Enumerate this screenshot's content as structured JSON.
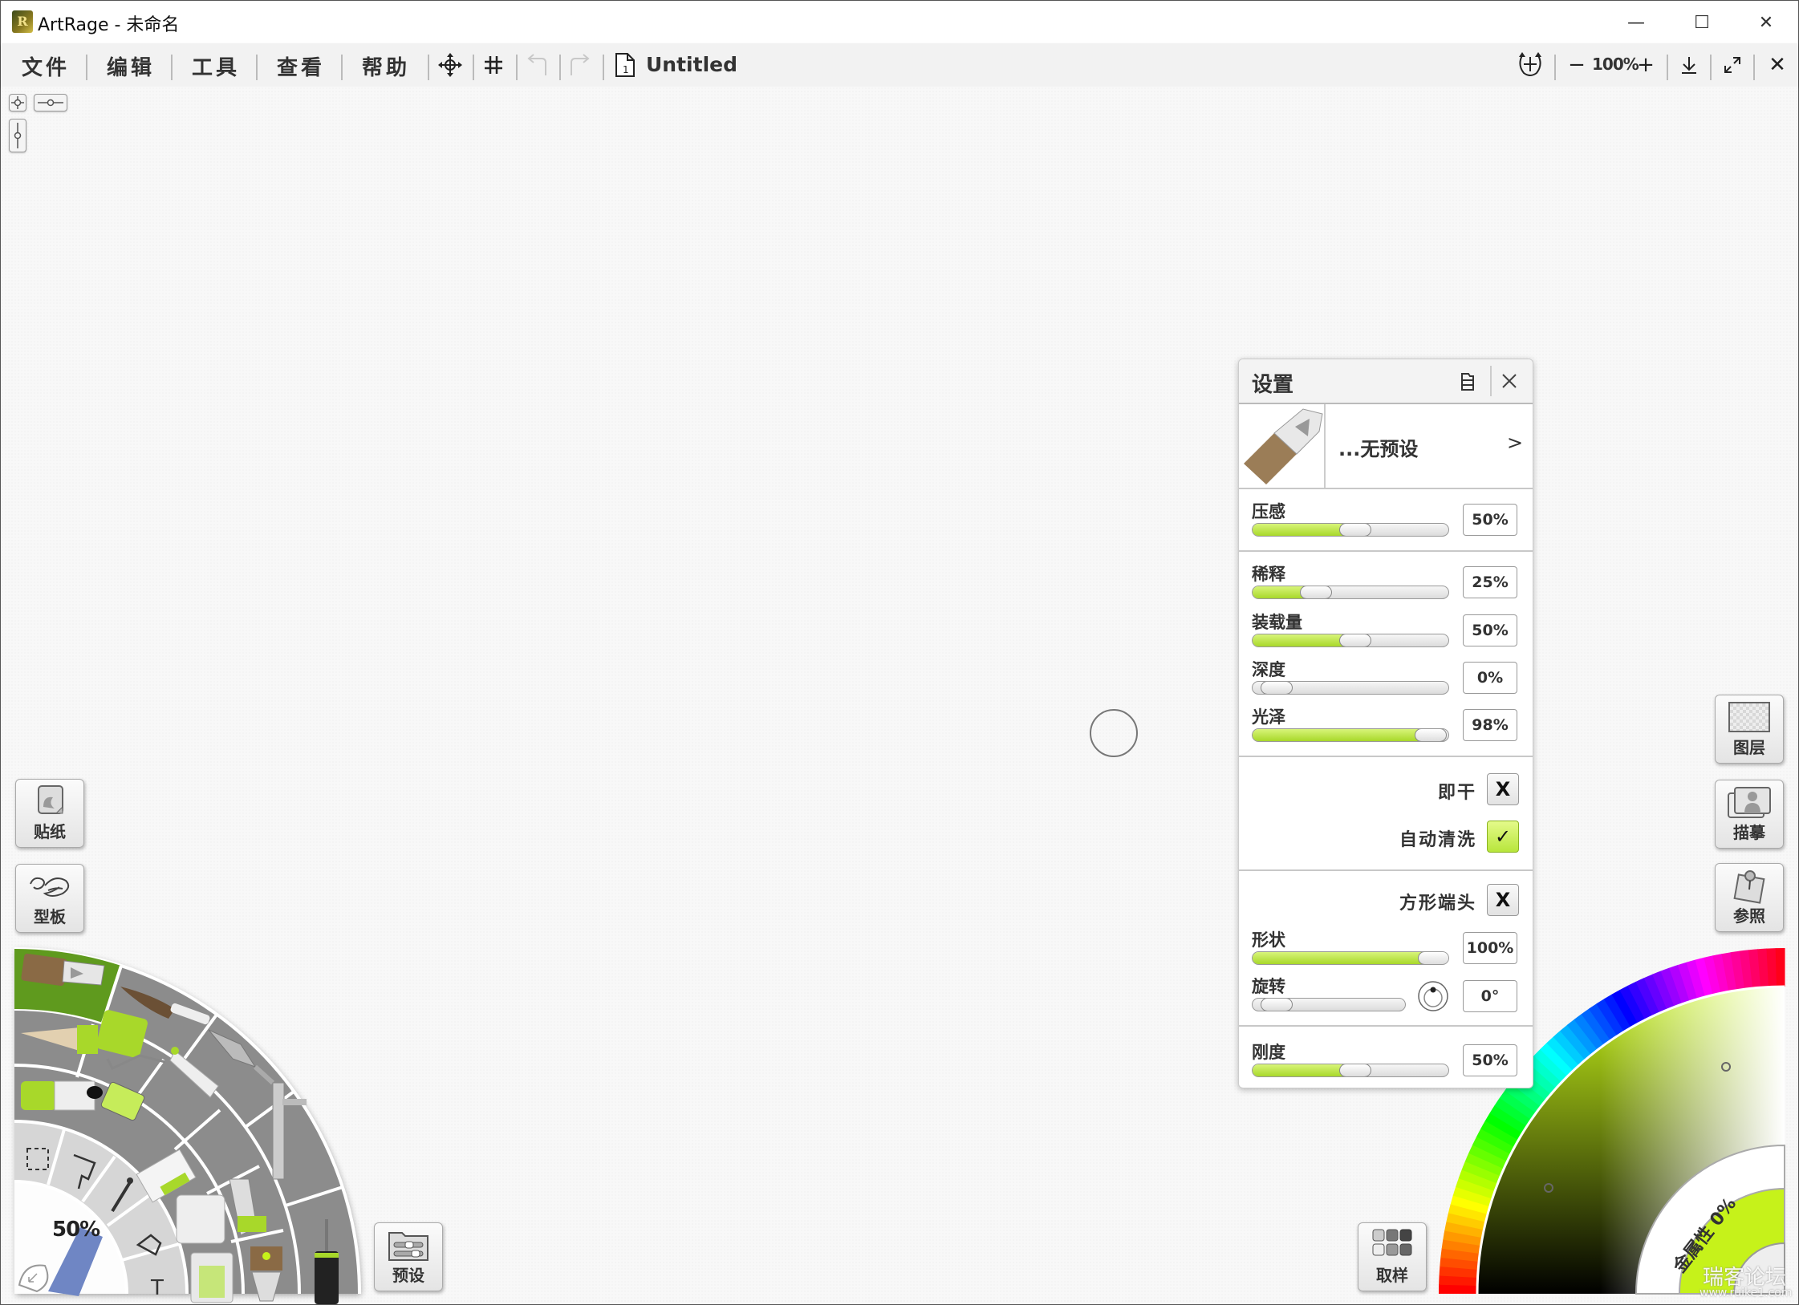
{
  "window": {
    "title": "ArtRage - 未命名",
    "app_icon_glyph": "R",
    "controls": {
      "minimize": "—",
      "maximize": "☐",
      "close": "✕"
    }
  },
  "toolbar": {
    "menus": [
      "文件",
      "编辑",
      "工具",
      "查看",
      "帮助"
    ],
    "icons": [
      "move-canvas-icon",
      "grid-icon",
      "undo-icon",
      "redo-icon",
      "document-icon"
    ],
    "document_title": "Untitled",
    "zoom_out": "−",
    "zoom_level": "100%",
    "zoom_in": "+",
    "close_glyph": "✕"
  },
  "left_panel": {
    "stickers_label": "贴纸",
    "stencils_label": "型板",
    "presets_label": "预设",
    "brush_size": "50%",
    "selected_tool": "oil-brush"
  },
  "right_panel": {
    "layers_label": "图层",
    "tracing_label": "描摹",
    "reference_label": "参照",
    "sampler_label": "取样",
    "metallic_label": "金属性 0%",
    "current_color": "#c6f21a"
  },
  "settings": {
    "title": "设置",
    "preset_name": "...无预设",
    "preset_arrow": ">",
    "sliders": [
      {
        "label": "压感",
        "value": "50%",
        "fraction": 0.5
      },
      {
        "label": "稀释",
        "value": "25%",
        "fraction": 0.25
      },
      {
        "label": "装载量",
        "value": "50%",
        "fraction": 0.5
      },
      {
        "label": "深度",
        "value": "0%",
        "fraction": 0.0
      },
      {
        "label": "光泽",
        "value": "98%",
        "fraction": 0.98
      }
    ],
    "instant_dry": {
      "label": "即干",
      "checked": false,
      "mark": "X"
    },
    "auto_clean": {
      "label": "自动清洗",
      "checked": true,
      "mark": "✓"
    },
    "square_head": {
      "label": "方形端头",
      "checked": false,
      "mark": "X"
    },
    "shape": {
      "label": "形状",
      "value": "100%",
      "fraction": 1.0
    },
    "rotation": {
      "label": "旋转",
      "value": "0°",
      "fraction": 0.0
    },
    "stiffness": {
      "label": "刚度",
      "value": "50%",
      "fraction": 0.5
    }
  },
  "colors": {
    "accent_green": "#a8d82a",
    "selected_tool_bg": "#5f9a1e"
  },
  "watermark": {
    "line1": "瑞客论坛",
    "line2": "www.ruike1.com"
  }
}
